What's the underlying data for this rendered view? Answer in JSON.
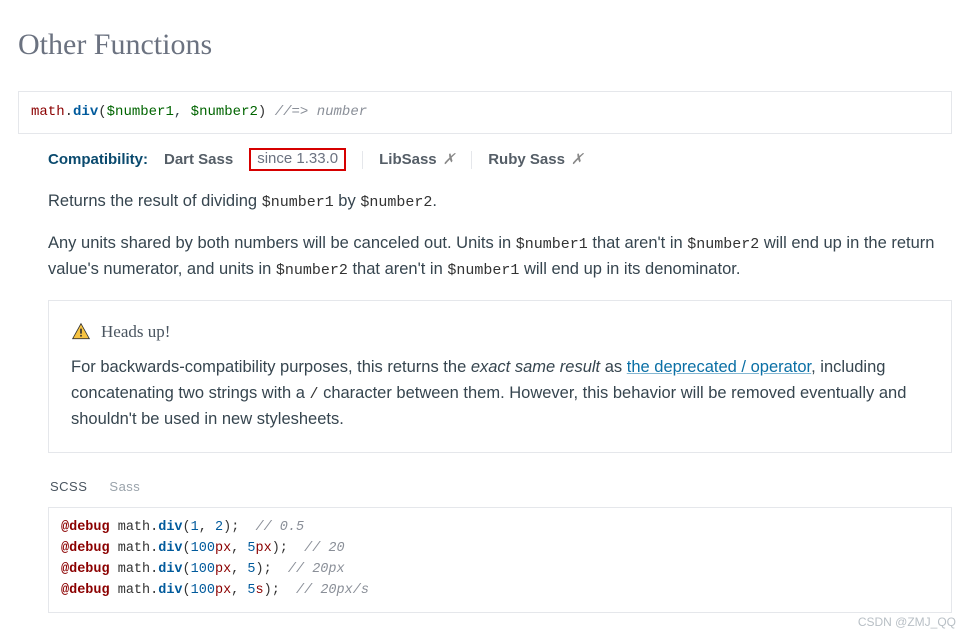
{
  "title": "Other Functions",
  "signature": {
    "namespace": "math",
    "function": "div",
    "arg1": "$number1",
    "arg2": "$number2",
    "comment": "//=> number"
  },
  "compat": {
    "label": "Compatibility:",
    "dart_sass": "Dart Sass",
    "since": "since 1.33.0",
    "libsass": "LibSass",
    "ruby_sass": "Ruby Sass",
    "x": "✗"
  },
  "para1": {
    "pre": "Returns the result of dividing ",
    "code1": "$number1",
    "mid": " by ",
    "code2": "$number2",
    "post": "."
  },
  "para2": {
    "pre": "Any units shared by both numbers will be canceled out. Units in ",
    "c1": "$number1",
    "m1": " that aren't in ",
    "c2": "$number2",
    "m2": " will end up in the return value's numerator, and units in ",
    "c3": "$number2",
    "m3": " that aren't in ",
    "c4": "$number1",
    "post": " will end up in its denominator."
  },
  "callout": {
    "title": "Heads up!",
    "pre": "For backwards-compatibility purposes, this returns the ",
    "em": "exact same result",
    "mid1": " as ",
    "link": "the deprecated / operator",
    "mid2": ", including concatenating two strings with a ",
    "slash": "/",
    "post": " character between them. However, this behavior will be removed eventually and shouldn't be used in new stylesheets."
  },
  "tabs": {
    "scss": "SCSS",
    "sass": "Sass"
  },
  "code": {
    "kw": "@debug",
    "mod": "math",
    "fn": "div",
    "lines": [
      {
        "a": "1",
        "au": "",
        "b": "2",
        "bu": "",
        "cmt": "// 0.5"
      },
      {
        "a": "100",
        "au": "px",
        "b": "5",
        "bu": "px",
        "cmt": "// 20"
      },
      {
        "a": "100",
        "au": "px",
        "b": "5",
        "bu": "",
        "cmt": "// 20px"
      },
      {
        "a": "100",
        "au": "px",
        "b": "5",
        "bu": "s",
        "cmt": "// 20px/s"
      }
    ]
  },
  "watermark": "CSDN @ZMJ_QQ"
}
